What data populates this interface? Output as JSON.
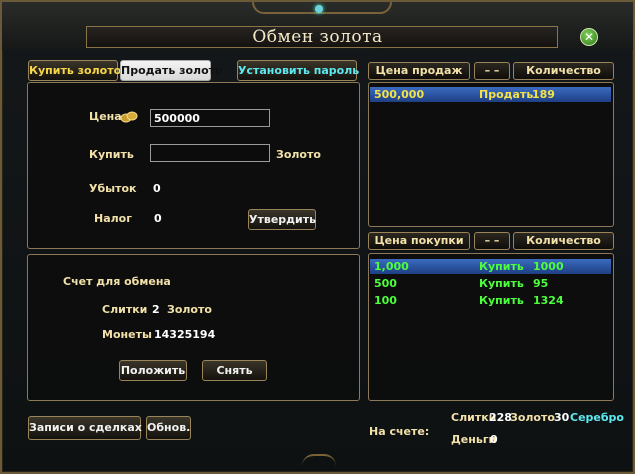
{
  "window": {
    "title": "Обмен золота"
  },
  "tabs": {
    "buy": "Купить золото",
    "sell": "Продать золото",
    "password": "Установить пароль"
  },
  "order_form": {
    "price_label": "Цена",
    "price_value": "500000",
    "buy_label": "Купить",
    "buy_value": "",
    "gold_label": "Золото",
    "loss_label": "Убыток",
    "loss_value": "0",
    "tax_label": "Налог",
    "tax_value": "0",
    "confirm_label": "Утвердить"
  },
  "exchange_account": {
    "title": "Счет для обмена",
    "bars_label": "Слитки",
    "bars_value": "2",
    "bars_unit": "Золото",
    "coins_label": "Монеты",
    "coins_value": "14325194",
    "deposit_label": "Положить",
    "withdraw_label": "Снять"
  },
  "sell_table": {
    "headers": [
      "Цена продаж",
      "– –",
      "Количество"
    ],
    "rows": [
      {
        "price": "500,000",
        "action": "Продать",
        "qty": "189"
      }
    ]
  },
  "buy_table": {
    "headers": [
      "Цена покупки",
      "– –",
      "Количество"
    ],
    "rows": [
      {
        "price": "1,000",
        "action": "Купить",
        "qty": "1000"
      },
      {
        "price": "500",
        "action": "Купить",
        "qty": "95"
      },
      {
        "price": "100",
        "action": "Купить",
        "qty": "1324"
      }
    ]
  },
  "footer": {
    "history_label": "Записи о сделках",
    "refresh_label": "Обнов.",
    "balance_label": "На счете:",
    "bars_label": "Слитки",
    "bars_value": "228",
    "gold_label": "Золото",
    "gold_value": "30",
    "silver_label": "Серебро",
    "money_label": "Деньги",
    "money_value": "0"
  },
  "colors": {
    "gold_text": "#f2e1a9",
    "buy_green": "#4cff3c",
    "sell_yellow": "#f3e24a",
    "selection_blue": "#2d55a8",
    "cyan": "#5ee9f0"
  }
}
